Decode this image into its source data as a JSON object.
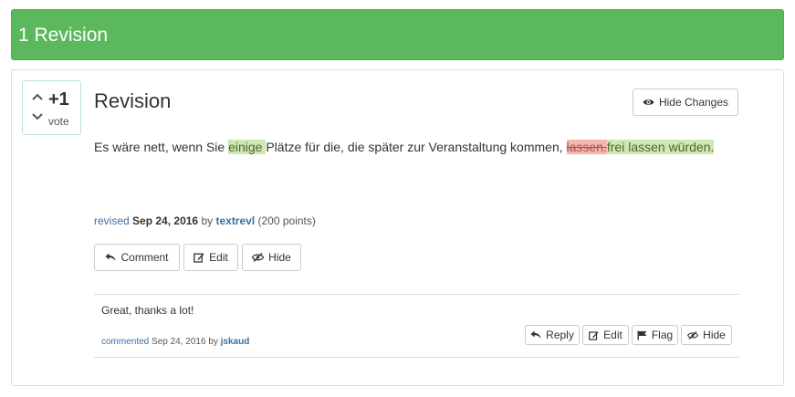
{
  "header": {
    "title": "1 Revision"
  },
  "revision": {
    "vote": {
      "count": "+1",
      "label": "vote"
    },
    "title": "Revision",
    "hide_changes_label": "Hide Changes",
    "diff": {
      "part1": "Es wäre nett, wenn Sie ",
      "ins1": "einige ",
      "part2": "Plätze für die, die später zur Veranstaltung kommen, ",
      "del1": "lassen.",
      "ins2": "frei lassen würden."
    },
    "meta": {
      "action": "revised",
      "date": "Sep 24, 2016",
      "by": "by",
      "user": "textrevl",
      "points": "(200 points)"
    },
    "actions": {
      "comment": "Comment",
      "edit": "Edit",
      "hide": "Hide"
    }
  },
  "comment": {
    "text": "Great, thanks a lot!",
    "meta": {
      "action": "commented",
      "date": "Sep 24, 2016",
      "by": "by",
      "user": "jskaud"
    },
    "actions": {
      "reply": "Reply",
      "edit": "Edit",
      "flag": "Flag",
      "hide": "Hide"
    }
  },
  "colors": {
    "header_bg": "#5cb85c",
    "insert_bg": "#cfe6b5",
    "delete_bg": "#f2b8b0",
    "link": "#3b6ea5"
  },
  "icons": [
    "chevron-up-icon",
    "chevron-down-icon",
    "eye-icon",
    "reply-icon",
    "edit-icon",
    "eye-slash-icon",
    "flag-icon"
  ]
}
